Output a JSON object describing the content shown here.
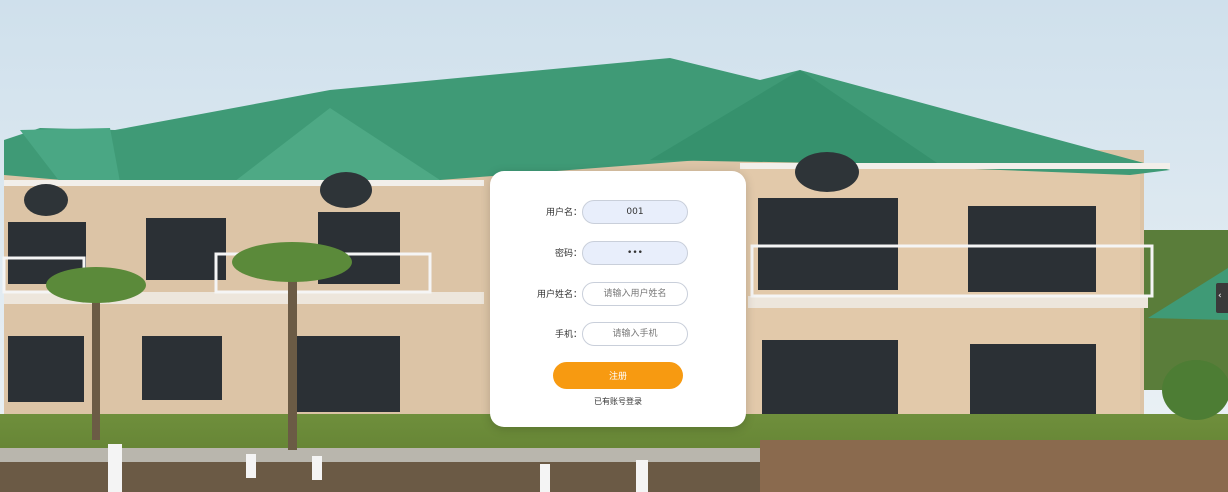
{
  "form": {
    "username_label": "用户名：",
    "username_value": "001",
    "password_label": "密码：",
    "password_value": "111",
    "realname_label": "用户姓名：",
    "realname_placeholder": "请输入用户姓名",
    "phone_label": "手机：",
    "phone_placeholder": "请输入手机",
    "submit_label": "注册",
    "login_link": "已有账号登录"
  },
  "colors": {
    "accent": "#f79a11",
    "roof": "#3f9a76",
    "wall": "#dcc4a6",
    "sky": "#d8e5ef"
  },
  "icons": {
    "edge_arrow": "chevron-left-icon"
  }
}
